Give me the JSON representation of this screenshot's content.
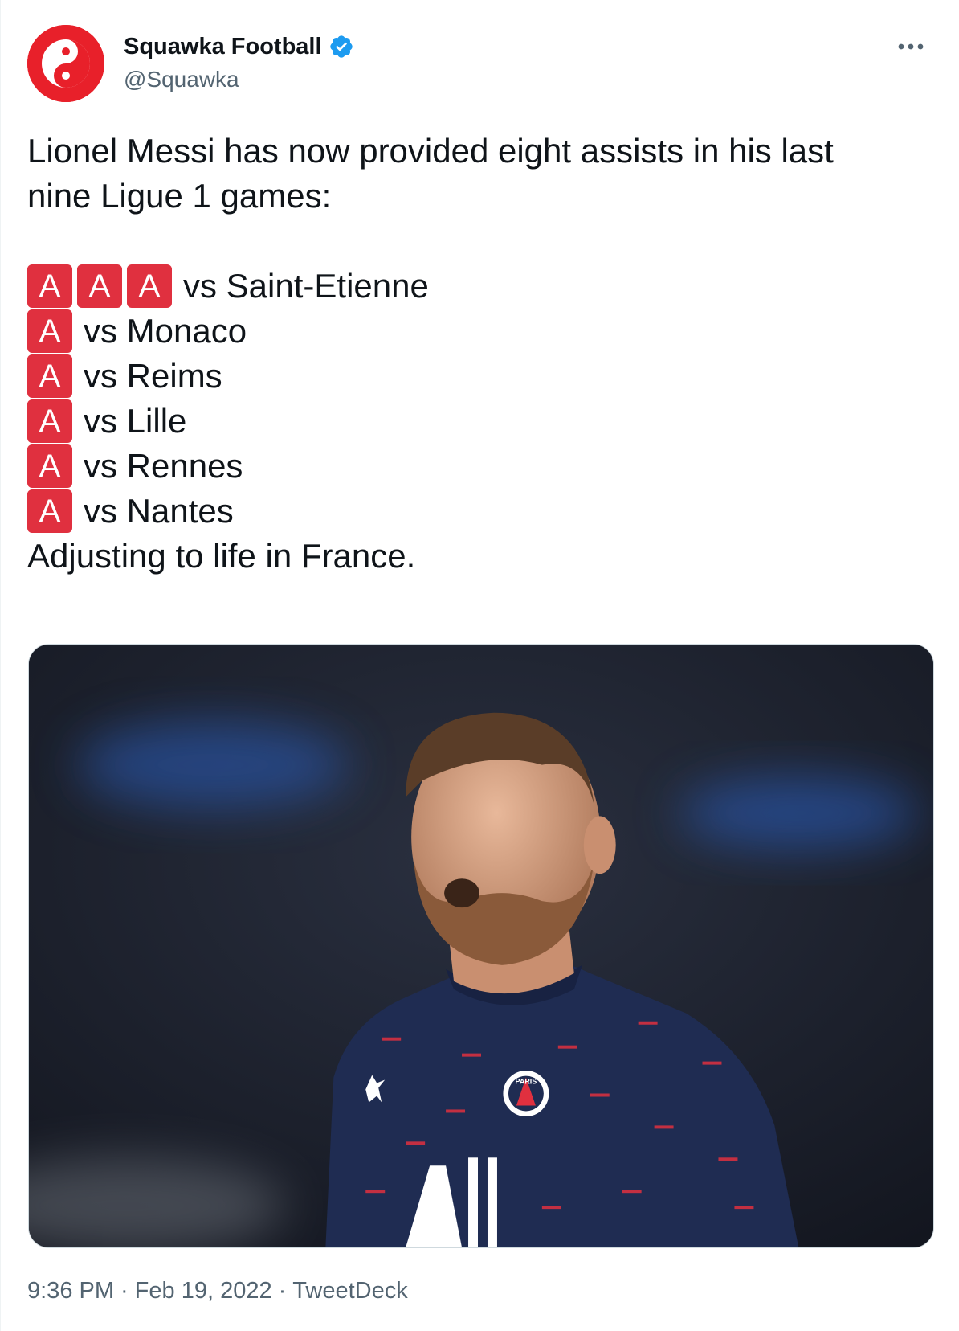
{
  "author": {
    "display_name": "Squawka Football",
    "handle": "@Squawka",
    "verified": true,
    "avatar_icon": "squawka-logo-icon",
    "brand_color": "#e8202a"
  },
  "tweet": {
    "intro_line1": "Lionel Messi has now provided eight assists in his last",
    "intro_line2": "nine Ligue 1 games:",
    "badge_letter": "A",
    "assists": [
      {
        "badges": 3,
        "text": "vs Saint-Etienne"
      },
      {
        "badges": 1,
        "text": "vs Monaco"
      },
      {
        "badges": 1,
        "text": "vs Reims"
      },
      {
        "badges": 1,
        "text": "vs Lille"
      },
      {
        "badges": 1,
        "text": "vs Rennes"
      },
      {
        "badges": 1,
        "text": "vs Nantes"
      }
    ],
    "closing": "Adjusting to life in France.",
    "badge_color": "#e0303f"
  },
  "media": {
    "type": "photo",
    "jersey_word": "PARIS"
  },
  "footer": {
    "time": "9:36 PM",
    "date": "Feb 19, 2022",
    "source": "TweetDeck",
    "separator": "·"
  },
  "icons": {
    "verified": "verified-badge-icon",
    "more": "more-options-icon"
  },
  "colors": {
    "text_primary": "#0f1419",
    "text_secondary": "#536471",
    "verified_blue": "#1d9bf0"
  }
}
